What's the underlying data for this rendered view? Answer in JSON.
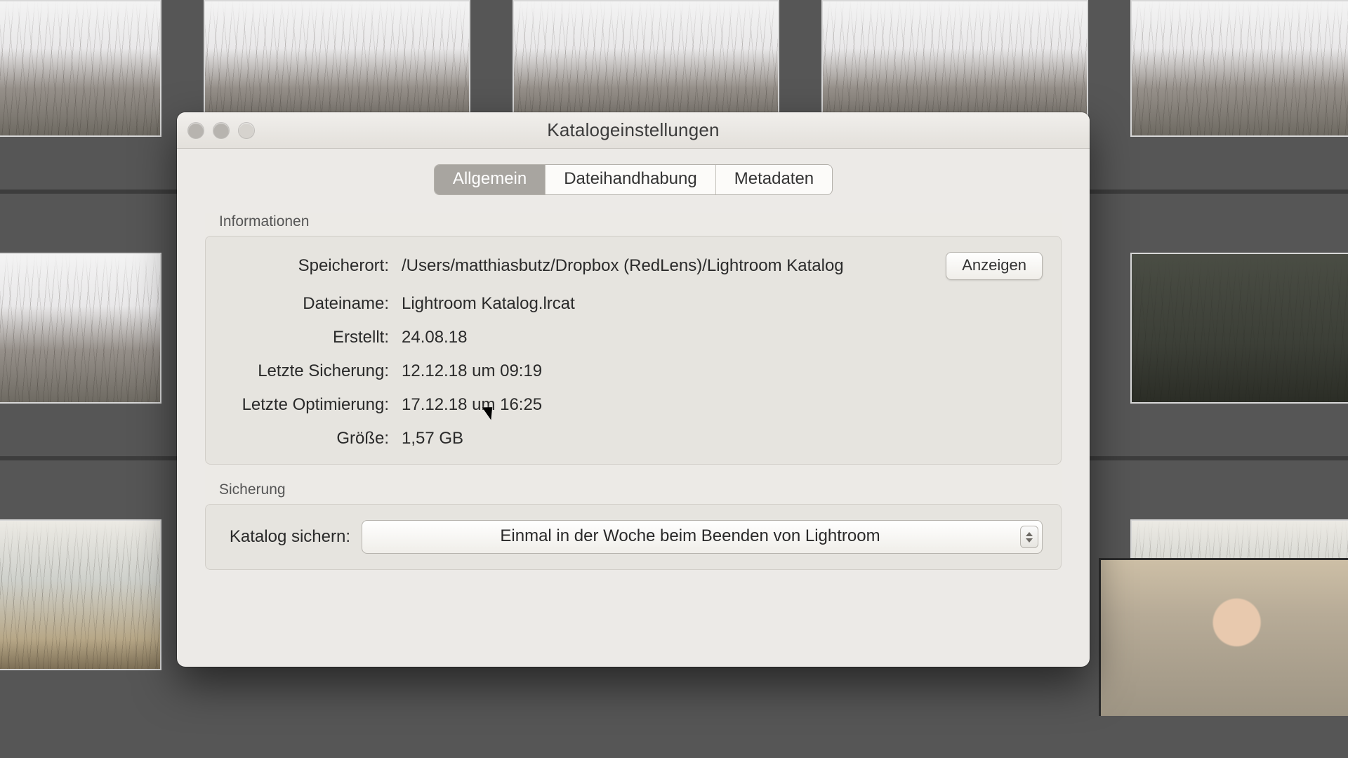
{
  "dialog": {
    "title": "Katalogeinstellungen",
    "tabs": {
      "general": "Allgemein",
      "filehandling": "Dateihandhabung",
      "metadata": "Metadaten"
    },
    "info": {
      "section_title": "Informationen",
      "location_label": "Speicherort:",
      "location_value": "/Users/matthiasbutz/Dropbox (RedLens)/Lightroom Katalog",
      "show_button": "Anzeigen",
      "filename_label": "Dateiname:",
      "filename_value": "Lightroom Katalog.lrcat",
      "created_label": "Erstellt:",
      "created_value": "24.08.18",
      "lastbackup_label": "Letzte Sicherung:",
      "lastbackup_value": "12.12.18 um 09:19",
      "lastopt_label": "Letzte Optimierung:",
      "lastopt_value": "17.12.18 um 16:25",
      "size_label": "Größe:",
      "size_value": "1,57 GB"
    },
    "backup": {
      "section_title": "Sicherung",
      "label": "Katalog sichern:",
      "selected": "Einmal in der Woche beim Beenden von Lightroom"
    }
  }
}
